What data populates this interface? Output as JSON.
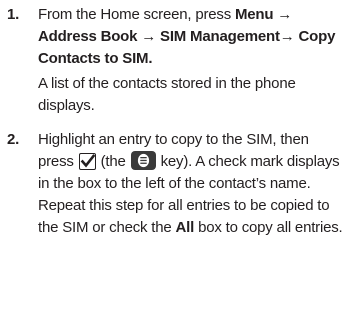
{
  "steps": [
    {
      "number": "1.",
      "instruction_prefix": "From the Home screen, press ",
      "instruction_bold": "Menu → Address Book → SIM Management→ Copy Contacts to SIM.",
      "result": "A list of the contacts stored in the phone displays."
    },
    {
      "number": "2.",
      "text_before_icon": "Highlight an entry to copy to the SIM, then press ",
      "checkbox_icon": "checkbox-checked-icon",
      "text_between_icons": " (the ",
      "key_icon": "options-key-icon",
      "text_after_icon": " key). A check mark displays in the box to the left of the contact’s name. Repeat this step for all entries to be copied to the SIM or check the ",
      "bold_word": "All",
      "text_end": " box to copy all entries."
    }
  ],
  "colors": {
    "text": "#231f20",
    "key_background": "#3a3a3a"
  }
}
